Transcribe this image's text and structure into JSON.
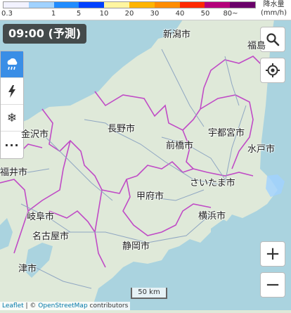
{
  "legend": {
    "colors": [
      "#f2f2ff",
      "#a0d2ff",
      "#218cff",
      "#0041ff",
      "#fff5a0",
      "#ffb400",
      "#ff8c00",
      "#ff2800",
      "#b4007a",
      "#6a006a"
    ],
    "ticks": [
      "0.3",
      "1",
      "5",
      "10",
      "20",
      "30",
      "40",
      "50",
      "80~"
    ],
    "unit_line1": "降水量",
    "unit_line2": "(mm/h)"
  },
  "time_label": "09:00 (予測)",
  "layers": [
    {
      "name": "rain-cloud-icon",
      "active": true
    },
    {
      "name": "lightning-icon",
      "active": false
    },
    {
      "name": "snowflake-icon",
      "active": false
    },
    {
      "name": "more-icon",
      "active": false
    }
  ],
  "cities": [
    {
      "id": "niigata",
      "label": "新潟市"
    },
    {
      "id": "fukushima",
      "label": "福島"
    },
    {
      "id": "kanazawa",
      "label": "金沢市"
    },
    {
      "id": "nagano",
      "label": "長野市"
    },
    {
      "id": "utsunomiya",
      "label": "宇都宮市"
    },
    {
      "id": "maebashi",
      "label": "前橋市"
    },
    {
      "id": "mito",
      "label": "水戸市"
    },
    {
      "id": "fukui",
      "label": "福井市"
    },
    {
      "id": "saitama",
      "label": "さいたま市"
    },
    {
      "id": "kofu",
      "label": "甲府市"
    },
    {
      "id": "gifu",
      "label": "岐阜市"
    },
    {
      "id": "yokohama",
      "label": "横浜市"
    },
    {
      "id": "nagoya",
      "label": "名古屋市"
    },
    {
      "id": "shizuoka",
      "label": "静岡市"
    },
    {
      "id": "tsu",
      "label": "津市"
    }
  ],
  "scale_label": "50 km",
  "attribution": {
    "leaflet": "Leaflet",
    "sep": " | © ",
    "osm": "OpenStreetMap",
    "contrib": " contributors"
  },
  "controls": {
    "zoom_in": "+",
    "zoom_out": "−"
  }
}
